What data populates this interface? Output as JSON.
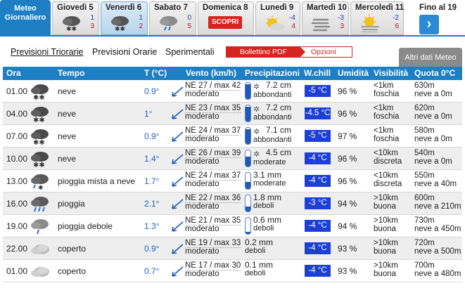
{
  "meteo_tab": {
    "line1": "Meteo",
    "line2": "Giornaliero"
  },
  "days": [
    {
      "name": "Giovedì 5",
      "min": "1",
      "max": "3",
      "icon": "snow-cloud-icon",
      "active": false
    },
    {
      "name": "Venerdì 6",
      "min": "1",
      "max": "2",
      "icon": "snow-cloud-icon",
      "active": true
    },
    {
      "name": "Sabato 7",
      "min": "0",
      "max": "5",
      "icon": "rain-cloud-icon",
      "active": false
    },
    {
      "name": "Domenica 8",
      "min": "",
      "max": "",
      "icon": "",
      "active": false,
      "cta": "SCOPRI"
    },
    {
      "name": "Lunedì 9",
      "min": "-4",
      "max": "4",
      "icon": "sun-cloud-icon",
      "active": false
    },
    {
      "name": "Martedì 10",
      "min": "-3",
      "max": "3",
      "icon": "fog-icon",
      "active": false
    },
    {
      "name": "Mercoledì 11",
      "min": "-2",
      "max": "6",
      "icon": "sun-fog-icon",
      "active": false
    }
  ],
  "fino": {
    "label": "Fino al 19",
    "arrow": "›"
  },
  "subnav": {
    "triorarie": "Previsioni Triorarie",
    "orarie": "Previsioni Orarie",
    "sperimentali": "Sperimentali",
    "bollettino": "Bollettino PDF",
    "opzioni": "Opzioni",
    "altri": "Altri dati Meteo"
  },
  "headers": {
    "ora": "Ora",
    "tempo": "Tempo",
    "temp": "T (°C)",
    "vento": "Vento (km/h)",
    "precip": "Precipitazioni",
    "wchill": "W.chill",
    "umid": "Umidità",
    "vis": "Visibilità",
    "quota": "Quota 0°C"
  },
  "rows": [
    {
      "ora": "01.00",
      "icon": "snow-cloud-icon",
      "desc": "neve",
      "temp": "0.9°",
      "wind_main": "NE 27 / max 42",
      "wind_sub": "moderato",
      "precip_amt": "7.2 cm",
      "precip_sub": "abbondanti",
      "precip_type": "snow",
      "level": 0.92,
      "wchill": "-5 °C",
      "umid": "96 %",
      "vis1": "<1km",
      "vis2": "foschia",
      "quota1": "630m",
      "quota2": "neve a 0m"
    },
    {
      "ora": "04.00",
      "icon": "snow-cloud-icon",
      "desc": "neve",
      "temp": "1°",
      "wind_main": "NE 23 / max 35",
      "wind_sub": "moderato",
      "precip_amt": "7.2 cm",
      "precip_sub": "abbondanti",
      "precip_type": "snow",
      "level": 0.92,
      "wchill": "-4.5 °C",
      "umid": "96 %",
      "vis1": "<1km",
      "vis2": "foschia",
      "quota1": "620m",
      "quota2": "neve a 0m"
    },
    {
      "ora": "07.00",
      "icon": "snow-cloud-icon",
      "desc": "neve",
      "temp": "0.9°",
      "wind_main": "NE 24 / max 37",
      "wind_sub": "moderato",
      "precip_amt": "7.1 cm",
      "precip_sub": "abbondanti",
      "precip_type": "snow",
      "level": 0.9,
      "wchill": "-5 °C",
      "umid": "97 %",
      "vis1": "<1km",
      "vis2": "foschia",
      "quota1": "580m",
      "quota2": "neve a 0m"
    },
    {
      "ora": "10.00",
      "icon": "snow-cloud-icon",
      "desc": "neve",
      "temp": "1.4°",
      "wind_main": "NE 26 / max 39",
      "wind_sub": "moderato",
      "precip_amt": "4.5 cm",
      "precip_sub": "moderate",
      "precip_type": "snow",
      "level": 0.6,
      "wchill": "-4 °C",
      "umid": "96 %",
      "vis1": "<10km",
      "vis2": "discreta",
      "quota1": "540m",
      "quota2": "neve a 0m"
    },
    {
      "ora": "13.00",
      "icon": "sleet-cloud-icon",
      "desc": "pioggia mista a neve",
      "temp": "1.7°",
      "wind_main": "NE 24 / max 37",
      "wind_sub": "moderato",
      "precip_amt": "3.1 mm",
      "precip_sub": "moderate",
      "precip_type": "rain",
      "level": 0.45,
      "wchill": "-4 °C",
      "umid": "96 %",
      "vis1": "<10km",
      "vis2": "discreta",
      "quota1": "550m",
      "quota2": "neve a 40m"
    },
    {
      "ora": "16.00",
      "icon": "rain-cloud-icon",
      "desc": "pioggia",
      "temp": "2.1°",
      "wind_main": "NE 22 / max 36",
      "wind_sub": "moderato",
      "precip_amt": "1.8 mm",
      "precip_sub": "deboli",
      "precip_type": "rain",
      "level": 0.3,
      "wchill": "-3 °C",
      "umid": "94 %",
      "vis1": ">10km",
      "vis2": "buona",
      "quota1": "600m",
      "quota2": "neve a 210m"
    },
    {
      "ora": "19.00",
      "icon": "light-rain-icon",
      "desc": "pioggia debole",
      "temp": "1.3°",
      "wind_main": "NE 21 / max 35",
      "wind_sub": "moderato",
      "precip_amt": "0.6 mm",
      "precip_sub": "deboli",
      "precip_type": "rain",
      "level": 0.15,
      "wchill": "-4 °C",
      "umid": "94 %",
      "vis1": ">10km",
      "vis2": "buona",
      "quota1": "730m",
      "quota2": "neve a 450m"
    },
    {
      "ora": "22.00",
      "icon": "overcast-icon",
      "desc": "coperto",
      "temp": "0.9°",
      "wind_main": "NE 19 / max 33",
      "wind_sub": "moderato",
      "precip_amt": "0.2 mm",
      "precip_sub": "deboli",
      "precip_type": "none",
      "level": 0,
      "wchill": "-4 °C",
      "umid": "93 %",
      "vis1": ">10km",
      "vis2": "buona",
      "quota1": "720m",
      "quota2": "neve a 500m"
    },
    {
      "ora": "01.00",
      "icon": "overcast-icon",
      "desc": "coperto",
      "temp": "0.7°",
      "wind_main": "NE 17 / max 30",
      "wind_sub": "moderato",
      "precip_amt": "0.1 mm",
      "precip_sub": "deboli",
      "precip_type": "none",
      "level": 0,
      "wchill": "-4 °C",
      "umid": "93 %",
      "vis1": ">10km",
      "vis2": "buona",
      "quota1": "700m",
      "quota2": "neve a 480m"
    }
  ],
  "colors": {
    "brand_blue": "#1e7fc4",
    "windchill_blue": "#1c3fd6",
    "temp_blue": "#1f63c2",
    "min_blue": "#1f3fb0",
    "max_red": "#c0102a",
    "cta_red": "#d8231e"
  }
}
